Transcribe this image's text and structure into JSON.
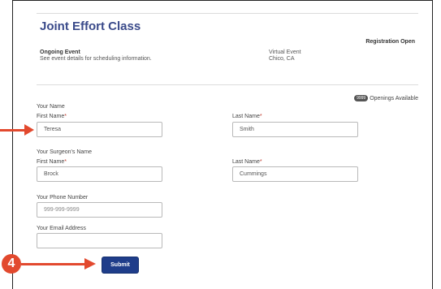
{
  "event": {
    "title": "Joint Effort Class",
    "status": "Registration Open",
    "type": "Ongoing Event",
    "description": "See event details for scheduling information.",
    "venue": "Virtual Event",
    "location": "Chico, CA",
    "openings_badge": "9999",
    "openings_label": "Openings Available"
  },
  "form": {
    "your_name_heading": "Your Name",
    "first_name_label": "First Name",
    "last_name_label": "Last Name",
    "required_marker": "*",
    "first_name_value": "Teresa",
    "last_name_value": "Smith",
    "surgeon_heading": "Your Surgeon's Name",
    "surgeon_first_value": "Brock",
    "surgeon_last_value": "Cummings",
    "phone_label": "Your Phone Number",
    "phone_placeholder": "999-999-9999",
    "email_label": "Your Email Address",
    "email_value": "",
    "submit_label": "Submit"
  },
  "annotation": {
    "step_number": "4",
    "accent_color": "#e2492e"
  },
  "colors": {
    "title": "#3a4a8a",
    "submit_bg": "#1f3d8a"
  }
}
